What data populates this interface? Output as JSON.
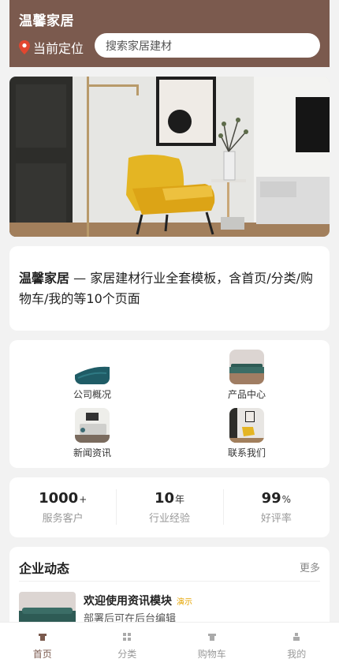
{
  "header": {
    "app_title": "温馨家居",
    "location_label": "当前定位",
    "search_placeholder": "搜索家居建材"
  },
  "intro": {
    "brand": "温馨家居",
    "text": " — 家居建材行业全套模板，含首页/分类/购物车/我的等10个页面"
  },
  "categories": [
    {
      "label": "公司概况",
      "icon": "sofa-icon"
    },
    {
      "label": "产品中心",
      "icon": "sofa-icon"
    },
    {
      "label": "新闻资讯",
      "icon": "sofa-icon"
    },
    {
      "label": "联系我们",
      "icon": "chair-icon"
    }
  ],
  "stats": [
    {
      "num": "1000",
      "unit": "+",
      "label": "服务客户"
    },
    {
      "num": "10",
      "unit": "年",
      "label": "行业经验"
    },
    {
      "num": "99",
      "unit": "%",
      "label": "好评率"
    }
  ],
  "news": {
    "title": "企业动态",
    "more": "更多",
    "item": {
      "title": "欢迎使用资讯模块",
      "tag": "演示",
      "summary": "部署后可在后台编辑"
    }
  },
  "tabs": [
    {
      "label": "首页",
      "icon": "home-icon",
      "active": true
    },
    {
      "label": "分类",
      "icon": "grid-icon",
      "active": false
    },
    {
      "label": "购物车",
      "icon": "cart-icon",
      "active": false
    },
    {
      "label": "我的",
      "icon": "user-icon",
      "active": false
    }
  ],
  "colors": {
    "brand": "#7b5a4e",
    "accent": "#e5a400",
    "background": "#f2f2f2"
  }
}
